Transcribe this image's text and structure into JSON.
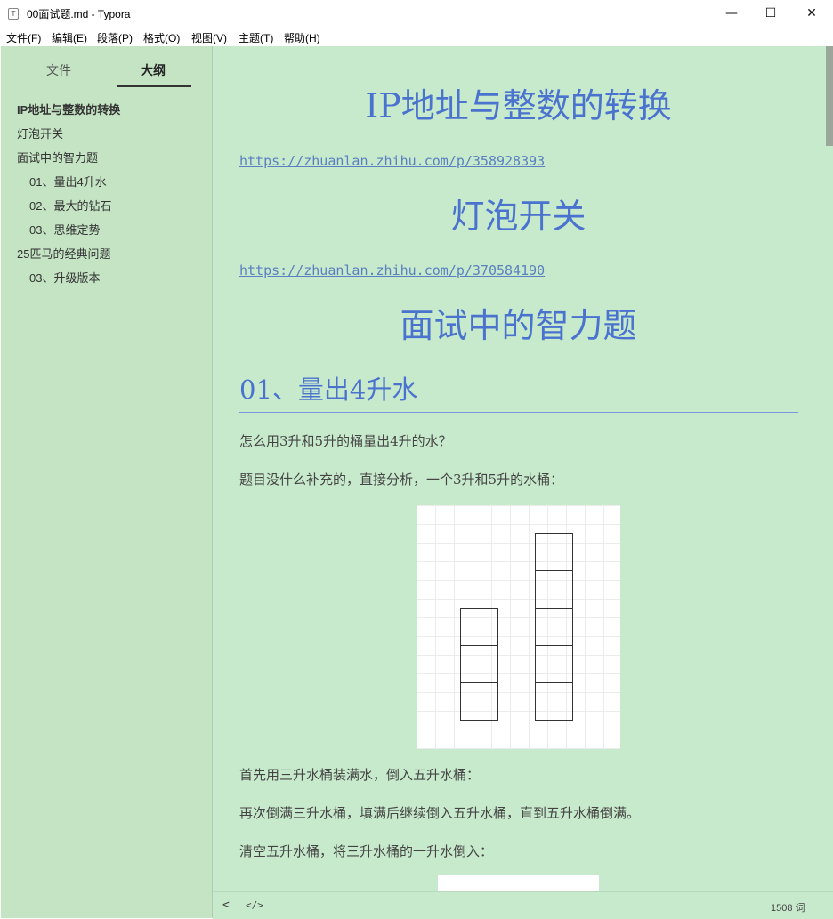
{
  "window": {
    "title": "00面试题.md - Typora",
    "icon_glyph": "T",
    "min_glyph": "—",
    "max_glyph": "☐",
    "close_glyph": "✕"
  },
  "menu": [
    "文件(F)",
    "编辑(E)",
    "段落(P)",
    "格式(O)",
    "视图(V)",
    "主题(T)",
    "帮助(H)"
  ],
  "sidebar": {
    "tabs": [
      "文件",
      "大纲"
    ],
    "active_tab": "大纲",
    "outline": [
      {
        "label": "IP地址与整数的转换",
        "level": 1,
        "active": true
      },
      {
        "label": "灯泡开关",
        "level": 1
      },
      {
        "label": "面试中的智力题",
        "level": 1
      },
      {
        "label": "01、量出4升水",
        "level": 2
      },
      {
        "label": "02、最大的钻石",
        "level": 2
      },
      {
        "label": "03、思维定势",
        "level": 2
      },
      {
        "label": "25匹马的经典问题",
        "level": 1
      },
      {
        "label": "03、升级版本",
        "level": 2
      }
    ]
  },
  "document": {
    "h1_1": "IP地址与整数的转换",
    "link_1": "https://zhuanlan.zhihu.com/p/358928393",
    "h1_2": "灯泡开关",
    "link_2": "https://zhuanlan.zhihu.com/p/370584190",
    "h1_3": "面试中的智力题",
    "h2_1": "01、量出4升水",
    "p1": "怎么用3升和5升的桶量出4升的水？",
    "p2": "题目没什么补充的，直接分析，一个3升和5升的水桶：",
    "p3": "首先用三升水桶装满水，倒入五升水桶：",
    "p4": "再次倒满三升水桶，填满后继续倒入五升水桶，直到五升水桶倒满。",
    "p5": "清空五升水桶，将三升水桶的一升水倒入："
  },
  "status": {
    "back_glyph": "<",
    "source_glyph": "</>",
    "word_count": "1508 词"
  },
  "colors": {
    "editor_bg": "#c8eacc",
    "sidebar_bg": "#c4e4c4",
    "heading": "#4a72cf",
    "link": "#5a80c0"
  }
}
